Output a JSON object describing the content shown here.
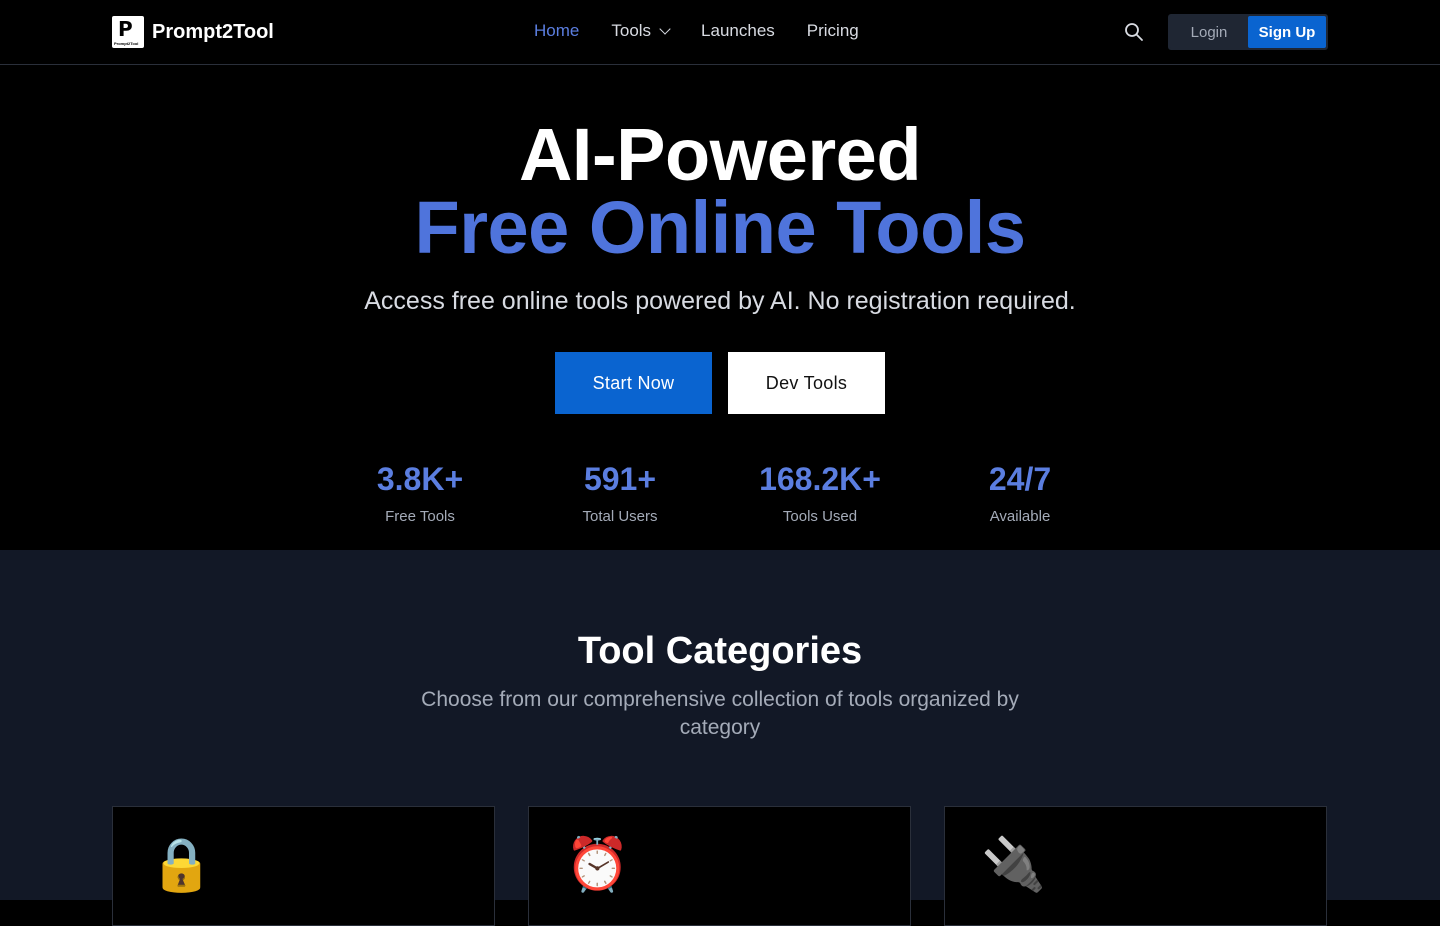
{
  "brand": {
    "name": "Prompt2Tool",
    "mark_big": "P",
    "mark_small": "Prompt2Tool"
  },
  "nav": {
    "items": [
      {
        "label": "Home",
        "active": true
      },
      {
        "label": "Tools",
        "has_dropdown": true
      },
      {
        "label": "Launches"
      },
      {
        "label": "Pricing"
      }
    ],
    "login_label": "Login",
    "signup_label": "Sign Up"
  },
  "hero": {
    "title_line1": "AI-Powered",
    "title_line2": "Free Online Tools",
    "subtitle": "Access free online tools powered by AI. No registration required.",
    "primary_button": "Start Now",
    "secondary_button": "Dev Tools",
    "stats": [
      {
        "value": "3.8K+",
        "label": "Free Tools"
      },
      {
        "value": "591+",
        "label": "Total Users"
      },
      {
        "value": "168.2K+",
        "label": "Tools Used"
      },
      {
        "value": "24/7",
        "label": "Available"
      }
    ]
  },
  "categories": {
    "title": "Tool Categories",
    "subtitle": "Choose from our comprehensive collection of tools organized by category",
    "cards": [
      {
        "icon": "🔒",
        "icon_name": "lock-icon"
      },
      {
        "icon": "⏰",
        "icon_name": "alarm-clock-icon"
      },
      {
        "icon": "🔌",
        "icon_name": "plug-icon"
      }
    ]
  },
  "colors": {
    "accent": "#4f74dc",
    "button_blue": "#0a64d0",
    "section_bg": "#121826"
  }
}
